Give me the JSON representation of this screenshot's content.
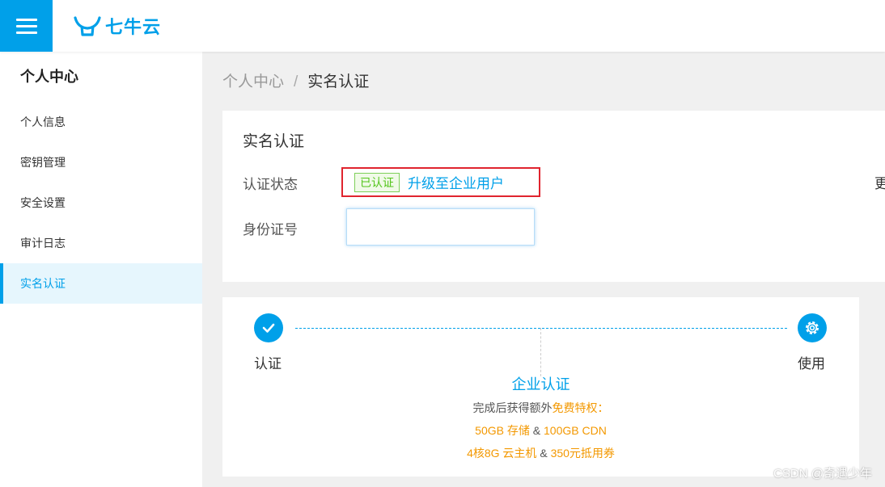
{
  "header": {
    "logo_text": "七牛云"
  },
  "sidebar": {
    "title": "个人中心",
    "items": [
      {
        "label": "个人信息"
      },
      {
        "label": "密钥管理"
      },
      {
        "label": "安全设置"
      },
      {
        "label": "审计日志"
      },
      {
        "label": "实名认证",
        "active": true
      }
    ]
  },
  "breadcrumb": {
    "parent": "个人中心",
    "separator": "/",
    "current": "实名认证"
  },
  "verify_card": {
    "title": "实名认证",
    "status_label": "认证状态",
    "status_badge": "已认证",
    "upgrade_link": "升级至企业用户",
    "id_label": "身份证号",
    "id_value": "",
    "cut_text": "更"
  },
  "steps_card": {
    "step_left": "认证",
    "step_right": "使用",
    "enterprise_title": "企业认证",
    "desc_prefix": "完成后获得额外",
    "desc_highlight": "免费特权：",
    "perk1_a": "50GB 存储",
    "perk1_sep": "&",
    "perk1_b": "100GB CDN",
    "perk2_a": "4核8G 云主机",
    "perk2_sep": "&",
    "perk2_b": "350元抵用券"
  },
  "watermark": "CSDN @奇遇少年",
  "colors": {
    "accent": "#00a0e9",
    "success": "#52c41a",
    "highlight": "#f39800",
    "error_border": "#e0242e"
  },
  "icons": {
    "menu": "hamburger-icon",
    "logo": "qiniu-bull-icon",
    "check": "check-icon",
    "gear": "gear-icon"
  }
}
